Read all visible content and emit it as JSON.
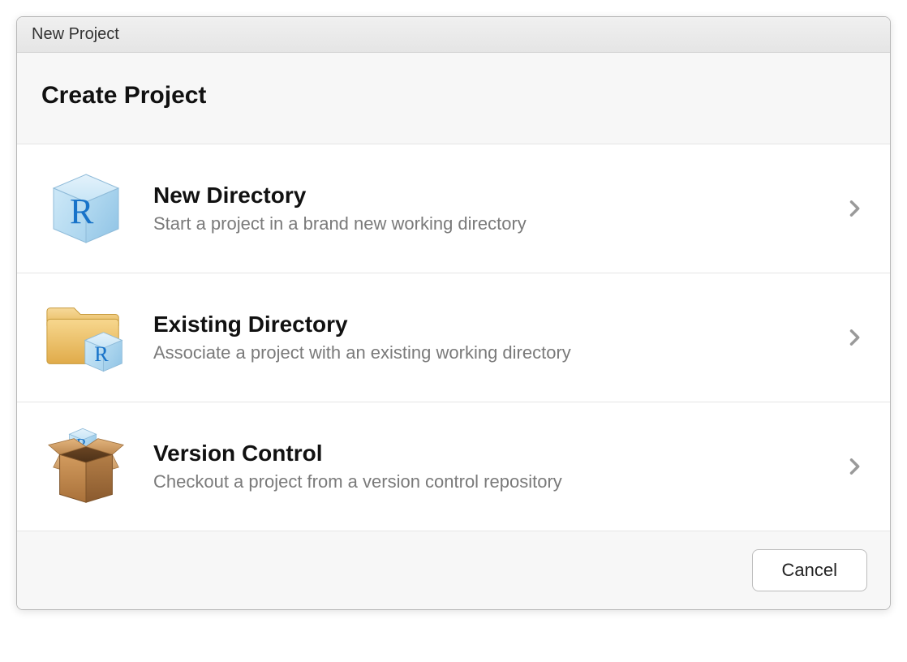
{
  "window": {
    "title": "New Project"
  },
  "header": {
    "title": "Create Project"
  },
  "options": [
    {
      "title": "New Directory",
      "desc": "Start a project in a brand new working directory"
    },
    {
      "title": "Existing Directory",
      "desc": "Associate a project with an existing working directory"
    },
    {
      "title": "Version Control",
      "desc": "Checkout a project from a version control repository"
    }
  ],
  "footer": {
    "cancel": "Cancel"
  }
}
